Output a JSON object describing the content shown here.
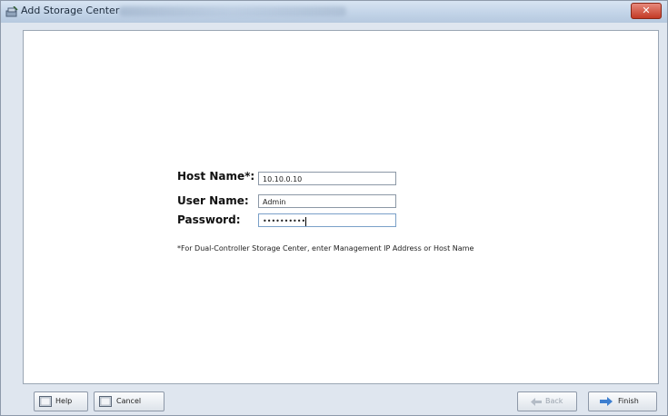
{
  "window": {
    "title": "Add Storage Center"
  },
  "form": {
    "host_name_label": "Host Name*:",
    "host_name_value": "10.10.0.10",
    "user_name_label": "User Name:",
    "user_name_value": "Admin",
    "password_label": "Password:",
    "password_value": "••••••••••",
    "note": "*For Dual-Controller Storage Center, enter Management IP Address or Host Name"
  },
  "buttons": {
    "help": "Help",
    "cancel": "Cancel",
    "back": "Back",
    "finish": "Finish"
  },
  "icons": {
    "title": "storage-add-icon",
    "help": "help-icon",
    "cancel": "cancel-icon",
    "back": "arrow-left-icon",
    "finish": "arrow-right-icon"
  }
}
